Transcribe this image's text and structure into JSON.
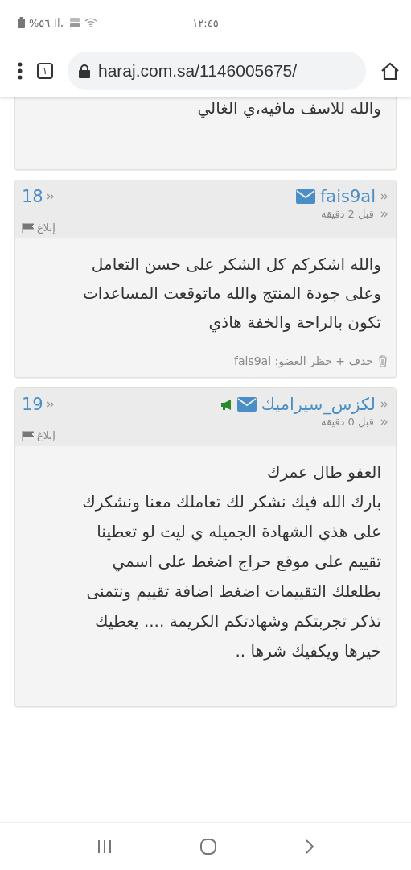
{
  "status_bar": {
    "battery_text": "%٥٦",
    "time": "١٢:٤٥"
  },
  "address_bar": {
    "tab_count": "١",
    "url": "haraj.com.sa/1146005675/"
  },
  "comments": [
    {
      "kind": "partial",
      "body": "والله للاسف مافيه،ي الغالي"
    },
    {
      "kind": "full",
      "number": "18",
      "author": "fais9al",
      "megaphone": false,
      "time": "قبل 2 دقيقه",
      "report": "إبلاغ",
      "body": "والله اشكركم كل الشكر على حسن التعامل\nوعلى جودة المنتج والله ماتوقعت المساعدات\nتكون بالراحة والخفة هاذي",
      "footer": "حذف + حظر العضو: fais9al"
    },
    {
      "kind": "full",
      "number": "19",
      "author": "لكزس_سيراميك",
      "megaphone": true,
      "time": "قبل 0 دقيقه",
      "report": "إبلاغ",
      "body": "العفو طال عمرك\nبارك الله فيك نشكر لك تعاملك معنا ونشكرك\nعلى هذي الشهادة الجميله ي ليت لو تعطينا\nتقييم على موقع حراج اضغط على اسمي\nيطلعلك التقييمات اضغط اضافة تقييم ونتمنى\nتذكر تجربتكم وشهادتكم الكريمة .... يعطيك\nخيرها ويكفيك شرها .."
    }
  ]
}
